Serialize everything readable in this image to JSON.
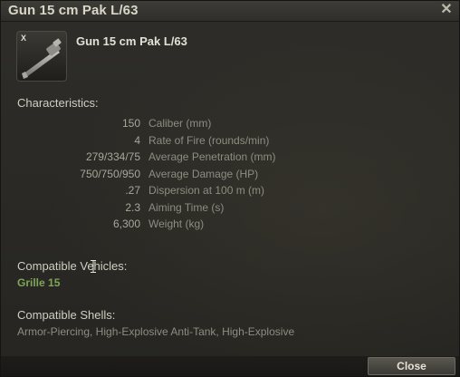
{
  "window": {
    "title": "Gun 15 cm Pak L/63"
  },
  "module": {
    "tier": "X",
    "name": "Gun 15 cm Pak L/63",
    "icon": "gun-icon"
  },
  "characteristics": {
    "label": "Characteristics:",
    "rows": [
      {
        "value": "150",
        "label": "Caliber (mm)"
      },
      {
        "value": "4",
        "label": "Rate of Fire (rounds/min)"
      },
      {
        "value": "279/334/75",
        "label": "Average Penetration (mm)"
      },
      {
        "value": "750/750/950",
        "label": "Average Damage (HP)"
      },
      {
        "value": ".27",
        "label": "Dispersion at 100 m (m)"
      },
      {
        "value": "2.3",
        "label": "Aiming Time (s)"
      },
      {
        "value": "6,300",
        "label": "Weight (kg)"
      }
    ]
  },
  "vehicles": {
    "label": "Compatible Vehicles:",
    "items": [
      "Grille 15"
    ]
  },
  "shells": {
    "label": "Compatible Shells:",
    "text": "Armor-Piercing, High-Explosive Anti-Tank, High-Explosive"
  },
  "footer": {
    "close_label": "Close"
  },
  "colors": {
    "accent_green": "#7fa657",
    "text_light": "#d1cec1",
    "text_dim": "#8f8c81"
  }
}
